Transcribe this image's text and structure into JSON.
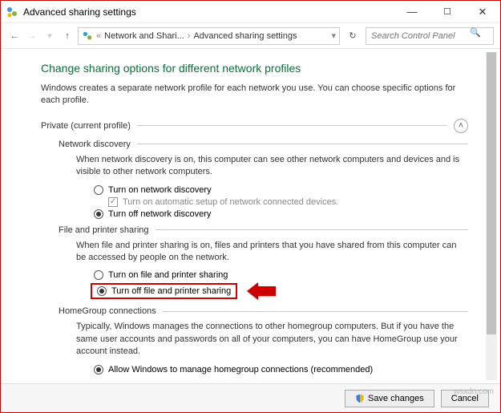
{
  "window": {
    "title": "Advanced sharing settings",
    "min": "—",
    "max": "☐",
    "close": "✕"
  },
  "nav": {
    "breadcrumb_prefix": "«",
    "crumb1": "Network and Shari...",
    "crumb2": "Advanced sharing settings",
    "search_placeholder": "Search Control Panel"
  },
  "page": {
    "heading": "Change sharing options for different network profiles",
    "intro": "Windows creates a separate network profile for each network you use. You can choose specific options for each profile."
  },
  "private": {
    "title": "Private (current profile)",
    "netdisc": {
      "title": "Network discovery",
      "desc": "When network discovery is on, this computer can see other network computers and devices and is visible to other network computers.",
      "on": "Turn on network discovery",
      "auto": "Turn on automatic setup of network connected devices.",
      "off": "Turn off network discovery"
    },
    "fps": {
      "title": "File and printer sharing",
      "desc": "When file and printer sharing is on, files and printers that you have shared from this computer can be accessed by people on the network.",
      "on": "Turn on file and printer sharing",
      "off": "Turn off file and printer sharing"
    },
    "hg": {
      "title": "HomeGroup connections",
      "desc": "Typically, Windows manages the connections to other homegroup computers. But if you have the same user accounts and passwords on all of your computers, you can have HomeGroup use your account instead.",
      "allow": "Allow Windows to manage homegroup connections (recommended)"
    }
  },
  "footer": {
    "save": "Save changes",
    "cancel": "Cancel"
  },
  "watermark": "wsxdn.com"
}
